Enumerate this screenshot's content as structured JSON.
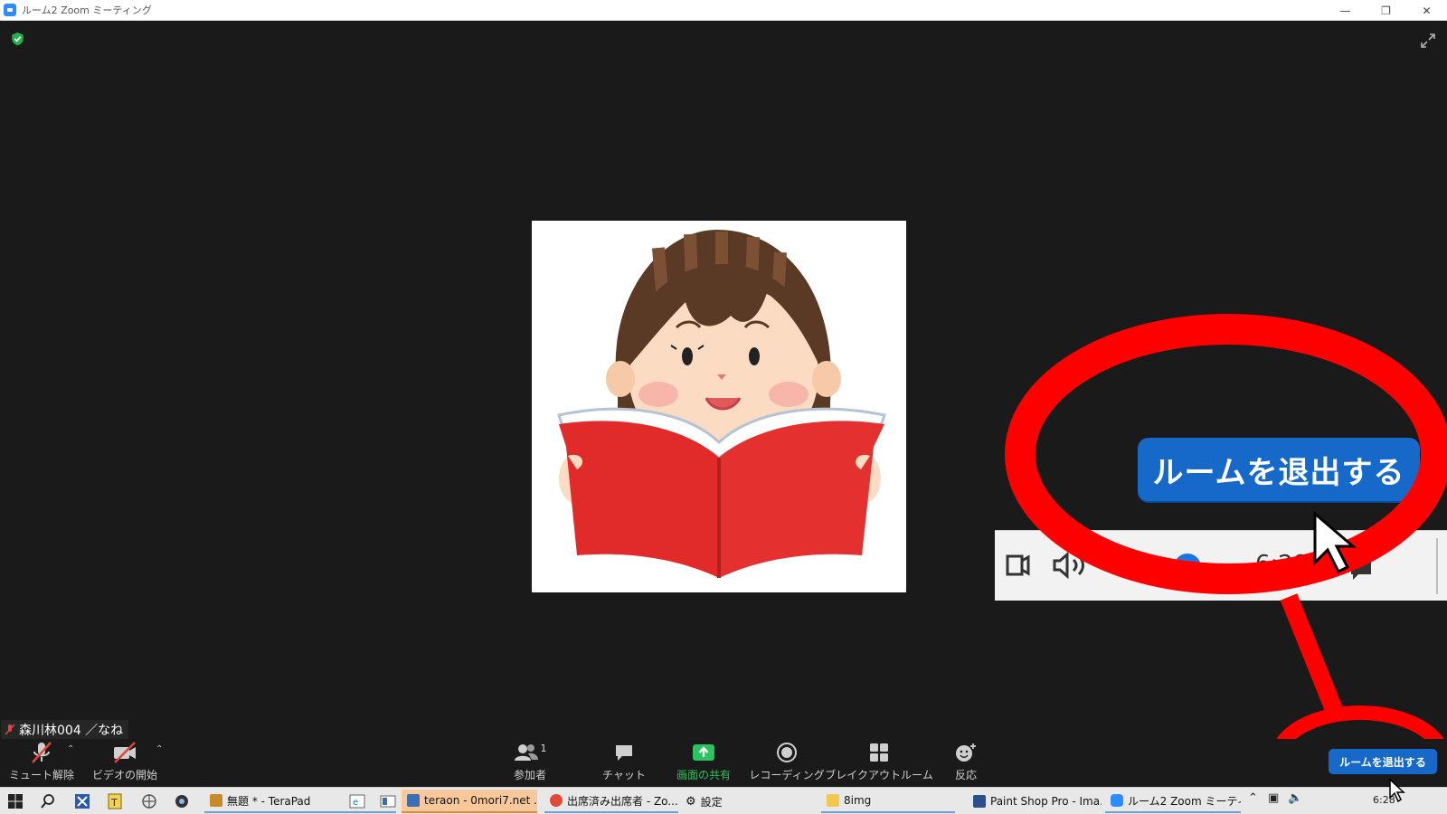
{
  "window": {
    "title": "ルーム2   Zoom ミーティング",
    "controls": [
      "—",
      "❐",
      "✕"
    ]
  },
  "stage": {
    "participant_name": "森川林004 ／なね",
    "tile_icons": [
      "shield-check-icon",
      "fullscreen-icon"
    ]
  },
  "annotation": {
    "leave_room_label": "ルームを退出する",
    "partial_clock": "6:28",
    "circle_color": "#ff0000"
  },
  "toolbar": {
    "unmute_label": "ミュート解除",
    "start_video_label": "ビデオの開始",
    "participants_label": "参加者",
    "participants_count": "1",
    "chat_label": "チャット",
    "share_screen_label": "画面の共有",
    "recording_label": "レコーディング",
    "breakout_label": "ブレイクアウトルーム",
    "reactions_label": "反応",
    "leave_room_label": "ルームを退出する"
  },
  "taskbar": {
    "items": [
      {
        "label": "無題 * - TeraPad",
        "icon_color": "#c98b2a"
      },
      {
        "label": "teraon - 0mori7.net ...",
        "icon_color": "#3a6fb3"
      },
      {
        "label": "出席済み出席者 - Zo...",
        "icon_color": "#dd4b39"
      },
      {
        "label": "設定",
        "icon_color": "#555555"
      },
      {
        "label": "8img",
        "icon_color": "#f2c94c"
      },
      {
        "label": "Paint Shop Pro - Ima...",
        "icon_color": "#2b4f8c"
      },
      {
        "label": "ルーム2   Zoom ミーティ...",
        "icon_color": "#2d8cff"
      }
    ],
    "clock_partial": "6:28"
  },
  "colors": {
    "accent_blue": "#1769c9",
    "share_green": "#29c45f",
    "stage_bg": "#1a1a1a",
    "mute_red": "#e0443a"
  }
}
